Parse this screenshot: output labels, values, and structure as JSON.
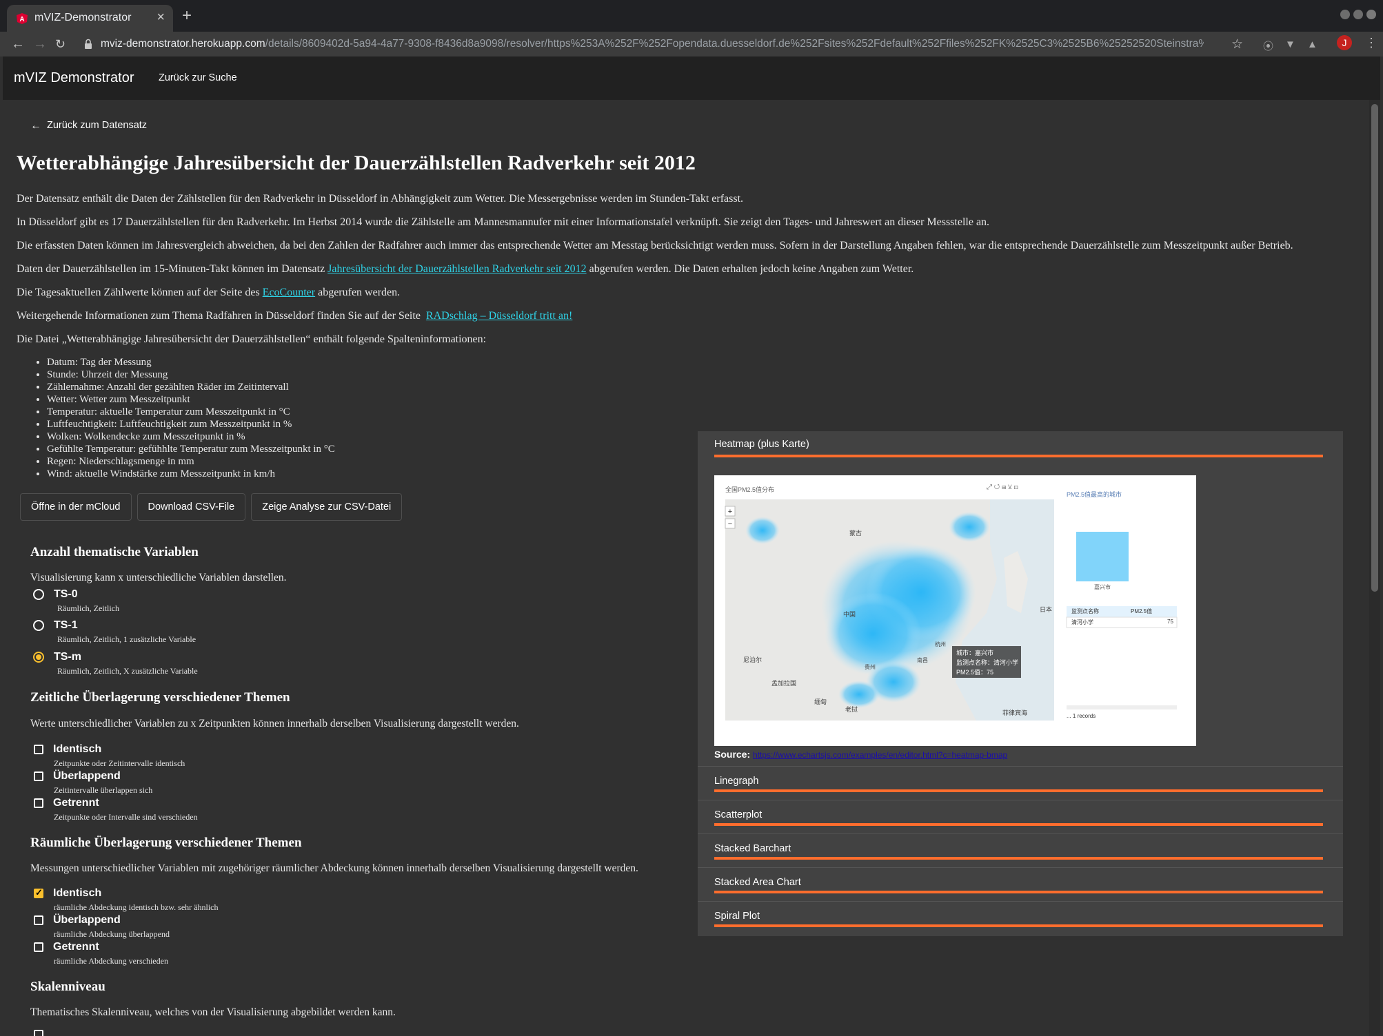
{
  "browser": {
    "tab_title": "mVIZ-Demonstrator",
    "url_host": "mviz-demonstrator.herokuapp.com",
    "url_path": "/details/8609402d-5a94-4a77-9308-f8436d8a9098/resolver/https%253A%252F%252Fopendata.duesseldorf.de%252Fsites%252Fdefault%252Ffiles%252FK%2525C3%2525B6%25252520Steinstra%2525C3%25259Fe%252525...",
    "avatar_letter": "J"
  },
  "header": {
    "app_title": "mVIZ Demonstrator",
    "back_to_search": "Zurück zur Suche"
  },
  "page": {
    "back_link": "Zurück zum Datensatz",
    "title": "Wetterabhängige Jahresübersicht der Dauerzählstellen Radverkehr seit 2012",
    "p1": "Der Datensatz enthält die Daten der Zählstellen für den Radverkehr in Düsseldorf in Abhängigkeit zum Wetter. Die Messergebnisse werden im Stunden-Takt erfasst.",
    "p2": "In Düsseldorf gibt es 17 Dauerzählstellen für den Radverkehr. Im Herbst 2014 wurde die Zählstelle am Mannesmannufer mit einer Informationstafel verknüpft. Sie zeigt den Tages- und Jahreswert an dieser Messstelle an.",
    "p3": "Die erfassten Daten können im Jahresvergleich abweichen, da bei den Zahlen der Radfahrer auch immer das entsprechende Wetter am Messtag berücksichtigt werden muss. Sofern in der Darstellung Angaben fehlen, war die entsprechende Dauerzählstelle zum Messzeitpunkt außer Betrieb.",
    "p4_pre": "Daten der Dauerzählstellen im 15-Minuten-Takt können im Datensatz ",
    "p4_link": "Jahresübersicht der Dauerzählstellen Radverkehr seit 2012",
    "p4_post": " abgerufen werden. Die Daten erhalten jedoch keine Angaben zum Wetter.",
    "p5_pre": "Die Tagesaktuellen Zählwerte können auf der Seite des ",
    "p5_link": "EcoCounter",
    "p5_post": " abgerufen werden.",
    "p6_pre": "Weitergehende Informationen zum Thema Radfahren in Düsseldorf finden Sie auf der Seite  ",
    "p6_link": "RADschlag – Düsseldorf tritt an!",
    "p7": "Die Datei „Wetterabhängige Jahresübersicht der Dauerzählstellen“ enthält folgende Spalteninformationen:",
    "columns": [
      "Datum: Tag der Messung",
      "Stunde: Uhrzeit der Messung",
      "Zählernahme: Anzahl der gezählten Räder im Zeitintervall",
      "Wetter: Wetter zum Messzeitpunkt",
      "Temperatur: aktuelle Temperatur zum Messzeitpunkt in °C",
      "Luftfeuchtigkeit: Luftfeuchtigkeit zum Messzeitpunkt in %",
      "Wolken: Wolkendecke zum Messzeitpunkt in %",
      "Gefühlte Temperatur: gefühhlte Temperatur zum Messzeitpunkt in °C",
      "Regen: Niederschlagsmenge in mm",
      "Wind: aktuelle Windstärke zum Messzeitpunkt in km/h"
    ],
    "buttons": {
      "open_mcloud": "Öffne in der mCloud",
      "download_csv": "Download CSV-File",
      "show_analysis": "Zeige Analyse zur CSV-Datei"
    }
  },
  "filters": {
    "thematic": {
      "title": "Anzahl thematische Variablen",
      "desc": "Visualisierung kann x unterschiedliche Variablen darstellen.",
      "options": [
        {
          "label": "TS-0",
          "sub": "Räumlich, Zeitlich",
          "selected": false
        },
        {
          "label": "TS-1",
          "sub": "Räumlich, Zeitlich, 1 zusätzliche Variable",
          "selected": false
        },
        {
          "label": "TS-m",
          "sub": "Räumlich, Zeitlich, X zusätzliche Variable",
          "selected": true
        }
      ]
    },
    "temporal": {
      "title": "Zeitliche Überlagerung verschiedener Themen",
      "desc": "Werte unterschiedlicher Variablen zu x Zeitpunkten können innerhalb derselben Visualisierung dargestellt werden.",
      "options": [
        {
          "label": "Identisch",
          "sub": "Zeitpunkte oder Zeitintervalle identisch",
          "checked": false
        },
        {
          "label": "Überlappend",
          "sub": "Zeitintervalle überlappen sich",
          "checked": false
        },
        {
          "label": "Getrennt",
          "sub": "Zeitpunkte oder Intervalle sind verschieden",
          "checked": false
        }
      ]
    },
    "spatial": {
      "title": "Räumliche Überlagerung verschiedener Themen",
      "desc": "Messungen unterschiedlicher Variablen mit zugehöriger räumlicher Abdeckung können innerhalb derselben Visualisierung dargestellt werden.",
      "options": [
        {
          "label": "Identisch",
          "sub": "räumliche Abdeckung identisch bzw. sehr ähnlich",
          "checked": true
        },
        {
          "label": "Überlappend",
          "sub": "räumliche Abdeckung überlappend",
          "checked": false
        },
        {
          "label": "Getrennt",
          "sub": "räumliche Abdeckung verschieden",
          "checked": false
        }
      ]
    },
    "scale": {
      "title": "Skalenniveau",
      "desc": "Thematisches Skalenniveau, welches von der Visualisierung abgebildet werden kann."
    }
  },
  "visualizations": {
    "expanded": {
      "title": "Heatmap (plus Karte)",
      "source_label": "Source:",
      "source_url": "https://www.echartsjs.com/examples/en/editor.html?c=heatmap-bmap"
    },
    "collapsed": [
      "Linegraph",
      "Scatterplot",
      "Stacked Barchart",
      "Stacked Area Chart",
      "Spiral Plot"
    ],
    "preview": {
      "chart_title": "全国PM2.5值分布",
      "side_title": "PM2.5值最高的城市",
      "bar_label": "嘉兴市",
      "table_headers": [
        "监测点名称",
        "PM2.5值"
      ],
      "table_row": [
        "清河小学",
        "75"
      ],
      "records": "... 1 records",
      "tooltip": [
        "城市：嘉兴市",
        "监测点名称：清河小学",
        "PM2.5值：75"
      ],
      "map_labels": [
        "蒙古",
        "中国",
        "尼泊尔",
        "孟加拉国",
        "缅甸",
        "老挝",
        "日本",
        "菲律宾海",
        "贵州",
        "南昌",
        "杭州"
      ]
    }
  },
  "colors": {
    "accent_orange": "#ff6d2d",
    "link_cyan": "#2fd2e6",
    "selection_yellow": "#fbc02d",
    "heat_blue": "#29b6f6"
  }
}
